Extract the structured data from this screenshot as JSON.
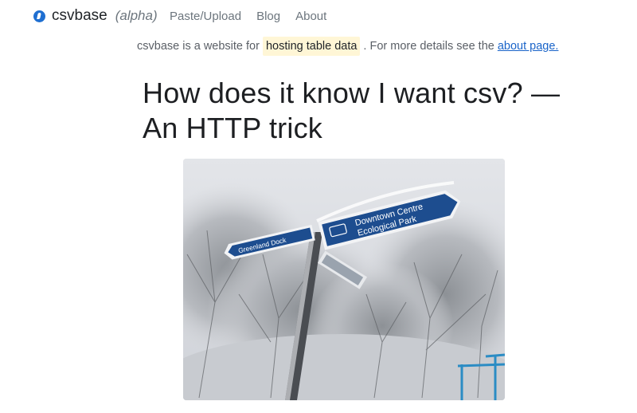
{
  "nav": {
    "brand_name": "csvbase",
    "brand_tag": "(alpha)",
    "brand_icon": "csvbase-logo-icon",
    "links": [
      {
        "label": "Paste/Upload"
      },
      {
        "label": "Blog"
      },
      {
        "label": "About"
      }
    ]
  },
  "tagline": {
    "prefix": "csvbase is a website for",
    "highlight": "hosting table data",
    "middle": ". For more details see the",
    "link": "about page."
  },
  "article": {
    "title": "How does it know I want csv? — An HTTP trick",
    "image": {
      "sign_text_1": "Downtown Centre",
      "sign_text_2": "Ecological Park",
      "sign_text_3": "Greenland Dock"
    }
  },
  "colors": {
    "accent": "#1f6fd1",
    "link": "#1a64c9",
    "highlight_bg": "#fff6d6",
    "sign_blue": "#1d4d8f"
  }
}
